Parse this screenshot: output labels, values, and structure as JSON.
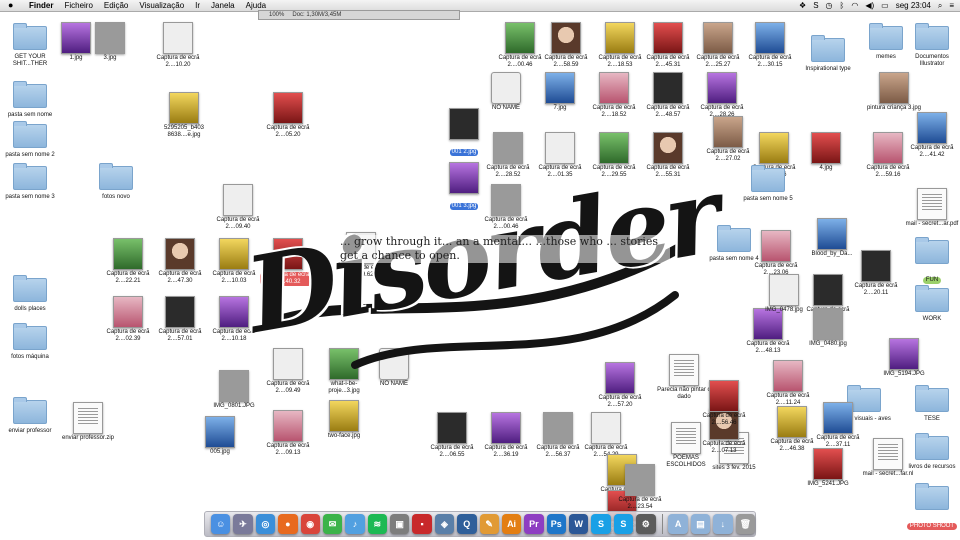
{
  "menubar": {
    "apple": "",
    "menus": [
      "Finder",
      "Ficheiro",
      "Edição",
      "Visualização",
      "Ir",
      "Janela",
      "Ajuda"
    ],
    "clock": "seg 23:04"
  },
  "window_strip": {
    "zoom": "100%",
    "doc": "Doc: 1,30M/3,45M"
  },
  "hero": {
    "word": "Disorder",
    "tagline": "... grow through it... an a mental... ...those who ... stories get a chance to open."
  },
  "desktop_items": [
    {
      "label": "GET YOUR SHIT...THER",
      "kind": "folder"
    },
    {
      "label": "1.jpg",
      "kind": "image"
    },
    {
      "label": "3.jpg",
      "kind": "image"
    },
    {
      "label": "Captura de ecrã 2....10.20",
      "kind": "image"
    },
    {
      "label": "Captura de ecrã 2....00.46",
      "kind": "image"
    },
    {
      "label": "Captura de ecrã 2....58.59",
      "kind": "image"
    },
    {
      "label": "Captura de ecrã 2....18.53",
      "kind": "image"
    },
    {
      "label": "Captura de ecrã 2....45.31",
      "kind": "image"
    },
    {
      "label": "Captura de ecrã 2....25.27",
      "kind": "image"
    },
    {
      "label": "Captura de ecrã 2....30.15",
      "kind": "image"
    },
    {
      "label": "Inspirational type",
      "kind": "folder"
    },
    {
      "label": "memes",
      "kind": "folder"
    },
    {
      "label": "Documentos Illustrator",
      "kind": "folder"
    },
    {
      "label": "pasta sem nome",
      "kind": "folder"
    },
    {
      "label": "pasta sem nome 2",
      "kind": "folder"
    },
    {
      "label": "pasta sem nome 3",
      "kind": "folder"
    },
    {
      "label": "fotos novo",
      "kind": "folder"
    },
    {
      "label": "5295205_b403 8638....e.jpg",
      "kind": "image"
    },
    {
      "label": "Captura de ecrã 2....05.20",
      "kind": "image"
    },
    {
      "label": "NO NAME",
      "kind": "drive"
    },
    {
      "label": "7.jpg",
      "kind": "image"
    },
    {
      "label": "Captura de ecrã 2....18.52",
      "kind": "image"
    },
    {
      "label": "Captura de ecrã 2....48.57",
      "kind": "image"
    },
    {
      "label": "Captura de ecrã 2....28.26",
      "kind": "image"
    },
    {
      "label": "Captura de ecrã 2....28.52",
      "kind": "image"
    },
    {
      "label": "Captura de ecrã 2....01.35",
      "kind": "image"
    },
    {
      "label": "Captura de ecrã 2....29.55",
      "kind": "image"
    },
    {
      "label": "Captura de ecrã 2....55.31",
      "kind": "image"
    },
    {
      "label": "Captura de ecrã 2....13.16",
      "kind": "image"
    },
    {
      "label": "4.jpg",
      "kind": "image"
    },
    {
      "label": "pintura criança 3.jpg",
      "kind": "image"
    },
    {
      "label": "Captura de ecrã 2....41.42",
      "kind": "image"
    },
    {
      "label": "Captura de ecrã 2....59.16",
      "kind": "image"
    },
    {
      "label": "001 2.jpg",
      "kind": "image",
      "selected": true
    },
    {
      "label": "001 3.jpg",
      "kind": "image",
      "selected": true
    },
    {
      "label": "Captura de ecrã 2....00.46",
      "kind": "image"
    },
    {
      "label": "Captura de ecrã 2....09.40",
      "kind": "image"
    },
    {
      "label": "Captura de ecrã 2....22.21",
      "kind": "image"
    },
    {
      "label": "Captura de ecrã 2....47.30",
      "kind": "image"
    },
    {
      "label": "Captura de ecrã 2....10.03",
      "kind": "image"
    },
    {
      "label": "Captura de ecrã 2....40.32",
      "kind": "image",
      "red": true
    },
    {
      "label": "dolls places",
      "kind": "folder"
    },
    {
      "label": "fotos máquina",
      "kind": "folder"
    },
    {
      "label": "Captura de ecrã 2....02.39",
      "kind": "image"
    },
    {
      "label": "Captura de ecrã 2....57.01",
      "kind": "image"
    },
    {
      "label": "Captura de ecrã 2....10.18",
      "kind": "image"
    },
    {
      "label": "IMG_0801.JPG",
      "kind": "image"
    },
    {
      "label": "Captura de ecrã 2....09.49",
      "kind": "image"
    },
    {
      "label": "what-i-be-proje...3.jpg",
      "kind": "image"
    },
    {
      "label": "NO NAME",
      "kind": "drive"
    },
    {
      "label": "two-face.jpg",
      "kind": "image"
    },
    {
      "label": "enviar professor",
      "kind": "folder"
    },
    {
      "label": "enviar professor.zip",
      "kind": "zip"
    },
    {
      "label": "005.jpg",
      "kind": "image"
    },
    {
      "label": "Captura de ecrã 2....09.13",
      "kind": "image"
    },
    {
      "label": "Captura de ecrã 2....06.55",
      "kind": "image"
    },
    {
      "label": "Captura de ecrã 2....36.19",
      "kind": "image"
    },
    {
      "label": "Captura de ecrã 2....56.37",
      "kind": "image"
    },
    {
      "label": "Captura de ecrã 2....54.29",
      "kind": "image"
    },
    {
      "label": "POEMAS ESCOLHIDOS",
      "kind": "docx"
    },
    {
      "label": "sites 3 fev. 2015",
      "kind": "rtf"
    },
    {
      "label": "Captura de ecrã 2....57.07",
      "kind": "image"
    },
    {
      "label": "Captura de ecrã 2....56.58",
      "kind": "image"
    },
    {
      "label": "pasta sem nome 5",
      "kind": "folder"
    },
    {
      "label": "pasta sem nome 4",
      "kind": "folder"
    },
    {
      "label": "FUN",
      "kind": "folder",
      "green": true
    },
    {
      "label": "WORK",
      "kind": "folder"
    },
    {
      "label": "IMG_5194.JPG",
      "kind": "image"
    },
    {
      "label": "ideias visuais - aves",
      "kind": "folder"
    },
    {
      "label": "TESE",
      "kind": "folder"
    },
    {
      "label": "livros de recursos",
      "kind": "folder"
    },
    {
      "label": "mail - secret...ar.pdf",
      "kind": "pdf"
    },
    {
      "label": "mail - secret...far.nl",
      "kind": "pdf"
    },
    {
      "label": "IMG_5241.JPG",
      "kind": "image"
    },
    {
      "label": "PHOTO SHOOT",
      "kind": "folder",
      "red": true
    },
    {
      "label": "Captura de ecrã 2....37.11",
      "kind": "image"
    },
    {
      "label": "Captura de ecrã 2....11.24",
      "kind": "image"
    },
    {
      "label": "Captura de ecrã 2....35.26",
      "kind": "image"
    },
    {
      "label": "Captura de ecrã 2....48.13",
      "kind": "image"
    },
    {
      "label": "IMG_0480.jpg",
      "kind": "image"
    },
    {
      "label": "IMG_0478.jpg",
      "kind": "image"
    },
    {
      "label": "Parecia não pintar o dado",
      "kind": "docx"
    },
    {
      "label": "Captura de ecrã 2....07.13",
      "kind": "image"
    },
    {
      "label": "Captura de ecrã 2....46.38",
      "kind": "image"
    },
    {
      "label": "Captura de ecrã 2....56.46",
      "kind": "image"
    },
    {
      "label": "Captura de ecrã 2....27.02",
      "kind": "image"
    },
    {
      "label": "Blood_by_Da...",
      "kind": "image"
    },
    {
      "label": "Captura de ecrã 2....23.06",
      "kind": "image"
    },
    {
      "label": "Captura de ecrã 2....20.11",
      "kind": "image"
    },
    {
      "label": "Captura de ecrã 2....57.20",
      "kind": "image"
    },
    {
      "label": "Captura de ecrã 2....23.54",
      "kind": "image"
    },
    {
      "label": "Captura de ecrã 2....09.62",
      "kind": "image"
    }
  ],
  "dock": {
    "apps": [
      {
        "name": "Finder",
        "glyph": "☺",
        "color": "#4a90e2"
      },
      {
        "name": "Launchpad",
        "glyph": "✈",
        "color": "#7a7a9a"
      },
      {
        "name": "Safari",
        "glyph": "◎",
        "color": "#3b8fd9"
      },
      {
        "name": "Firefox",
        "glyph": "●",
        "color": "#e86a1f"
      },
      {
        "name": "Chrome",
        "glyph": "◉",
        "color": "#d9453b"
      },
      {
        "name": "Messages",
        "glyph": "✉",
        "color": "#3bb34a"
      },
      {
        "name": "Music",
        "glyph": "♪",
        "color": "#52a0e0"
      },
      {
        "name": "Spotify",
        "glyph": "≋",
        "color": "#1db954"
      },
      {
        "name": "Archive",
        "glyph": "▣",
        "color": "#7d7d7d"
      },
      {
        "name": "Photo Booth",
        "glyph": "▪",
        "color": "#c8292b"
      },
      {
        "name": "Preview",
        "glyph": "◈",
        "color": "#5a7fa8"
      },
      {
        "name": "QuickTime",
        "glyph": "Q",
        "color": "#2f5f9a"
      },
      {
        "name": "Pages",
        "glyph": "✎",
        "color": "#e19a35"
      },
      {
        "name": "Illustrator",
        "glyph": "Ai",
        "color": "#e37e13"
      },
      {
        "name": "Premiere",
        "glyph": "Pr",
        "color": "#8e3ec2"
      },
      {
        "name": "Photoshop",
        "glyph": "Ps",
        "color": "#1f76c9"
      },
      {
        "name": "Word",
        "glyph": "W",
        "color": "#2b5797"
      },
      {
        "name": "Skype",
        "glyph": "S",
        "color": "#1aa0e6"
      },
      {
        "name": "Skype2",
        "glyph": "S",
        "color": "#1aa0e6"
      },
      {
        "name": "Utility",
        "glyph": "⚙",
        "color": "#5b5b5b"
      }
    ],
    "right": [
      {
        "name": "Applications",
        "glyph": "A",
        "color": "#8fb2d8"
      },
      {
        "name": "Documents",
        "glyph": "▤",
        "color": "#8fb2d8"
      },
      {
        "name": "Downloads",
        "glyph": "↓",
        "color": "#8fb2d8"
      },
      {
        "name": "Trash",
        "glyph": "🗑",
        "color": "#9a9a9a"
      }
    ]
  }
}
